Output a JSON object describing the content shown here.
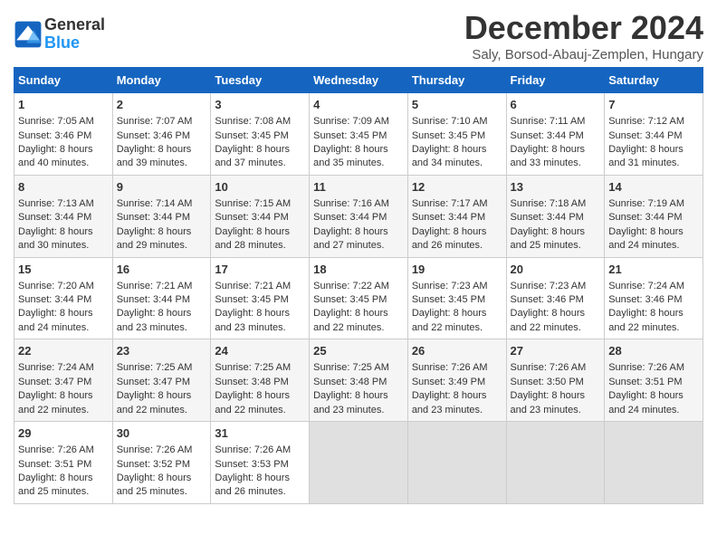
{
  "logo": {
    "text_general": "General",
    "text_blue": "Blue"
  },
  "title": "December 2024",
  "subtitle": "Saly, Borsod-Abauj-Zemplen, Hungary",
  "header": {
    "days": [
      "Sunday",
      "Monday",
      "Tuesday",
      "Wednesday",
      "Thursday",
      "Friday",
      "Saturday"
    ]
  },
  "weeks": [
    {
      "cells": [
        {
          "day": "1",
          "lines": [
            "Sunrise: 7:05 AM",
            "Sunset: 3:46 PM",
            "Daylight: 8 hours",
            "and 40 minutes."
          ]
        },
        {
          "day": "2",
          "lines": [
            "Sunrise: 7:07 AM",
            "Sunset: 3:46 PM",
            "Daylight: 8 hours",
            "and 39 minutes."
          ]
        },
        {
          "day": "3",
          "lines": [
            "Sunrise: 7:08 AM",
            "Sunset: 3:45 PM",
            "Daylight: 8 hours",
            "and 37 minutes."
          ]
        },
        {
          "day": "4",
          "lines": [
            "Sunrise: 7:09 AM",
            "Sunset: 3:45 PM",
            "Daylight: 8 hours",
            "and 35 minutes."
          ]
        },
        {
          "day": "5",
          "lines": [
            "Sunrise: 7:10 AM",
            "Sunset: 3:45 PM",
            "Daylight: 8 hours",
            "and 34 minutes."
          ]
        },
        {
          "day": "6",
          "lines": [
            "Sunrise: 7:11 AM",
            "Sunset: 3:44 PM",
            "Daylight: 8 hours",
            "and 33 minutes."
          ]
        },
        {
          "day": "7",
          "lines": [
            "Sunrise: 7:12 AM",
            "Sunset: 3:44 PM",
            "Daylight: 8 hours",
            "and 31 minutes."
          ]
        }
      ]
    },
    {
      "cells": [
        {
          "day": "8",
          "lines": [
            "Sunrise: 7:13 AM",
            "Sunset: 3:44 PM",
            "Daylight: 8 hours",
            "and 30 minutes."
          ]
        },
        {
          "day": "9",
          "lines": [
            "Sunrise: 7:14 AM",
            "Sunset: 3:44 PM",
            "Daylight: 8 hours",
            "and 29 minutes."
          ]
        },
        {
          "day": "10",
          "lines": [
            "Sunrise: 7:15 AM",
            "Sunset: 3:44 PM",
            "Daylight: 8 hours",
            "and 28 minutes."
          ]
        },
        {
          "day": "11",
          "lines": [
            "Sunrise: 7:16 AM",
            "Sunset: 3:44 PM",
            "Daylight: 8 hours",
            "and 27 minutes."
          ]
        },
        {
          "day": "12",
          "lines": [
            "Sunrise: 7:17 AM",
            "Sunset: 3:44 PM",
            "Daylight: 8 hours",
            "and 26 minutes."
          ]
        },
        {
          "day": "13",
          "lines": [
            "Sunrise: 7:18 AM",
            "Sunset: 3:44 PM",
            "Daylight: 8 hours",
            "and 25 minutes."
          ]
        },
        {
          "day": "14",
          "lines": [
            "Sunrise: 7:19 AM",
            "Sunset: 3:44 PM",
            "Daylight: 8 hours",
            "and 24 minutes."
          ]
        }
      ]
    },
    {
      "cells": [
        {
          "day": "15",
          "lines": [
            "Sunrise: 7:20 AM",
            "Sunset: 3:44 PM",
            "Daylight: 8 hours",
            "and 24 minutes."
          ]
        },
        {
          "day": "16",
          "lines": [
            "Sunrise: 7:21 AM",
            "Sunset: 3:44 PM",
            "Daylight: 8 hours",
            "and 23 minutes."
          ]
        },
        {
          "day": "17",
          "lines": [
            "Sunrise: 7:21 AM",
            "Sunset: 3:45 PM",
            "Daylight: 8 hours",
            "and 23 minutes."
          ]
        },
        {
          "day": "18",
          "lines": [
            "Sunrise: 7:22 AM",
            "Sunset: 3:45 PM",
            "Daylight: 8 hours",
            "and 22 minutes."
          ]
        },
        {
          "day": "19",
          "lines": [
            "Sunrise: 7:23 AM",
            "Sunset: 3:45 PM",
            "Daylight: 8 hours",
            "and 22 minutes."
          ]
        },
        {
          "day": "20",
          "lines": [
            "Sunrise: 7:23 AM",
            "Sunset: 3:46 PM",
            "Daylight: 8 hours",
            "and 22 minutes."
          ]
        },
        {
          "day": "21",
          "lines": [
            "Sunrise: 7:24 AM",
            "Sunset: 3:46 PM",
            "Daylight: 8 hours",
            "and 22 minutes."
          ]
        }
      ]
    },
    {
      "cells": [
        {
          "day": "22",
          "lines": [
            "Sunrise: 7:24 AM",
            "Sunset: 3:47 PM",
            "Daylight: 8 hours",
            "and 22 minutes."
          ]
        },
        {
          "day": "23",
          "lines": [
            "Sunrise: 7:25 AM",
            "Sunset: 3:47 PM",
            "Daylight: 8 hours",
            "and 22 minutes."
          ]
        },
        {
          "day": "24",
          "lines": [
            "Sunrise: 7:25 AM",
            "Sunset: 3:48 PM",
            "Daylight: 8 hours",
            "and 22 minutes."
          ]
        },
        {
          "day": "25",
          "lines": [
            "Sunrise: 7:25 AM",
            "Sunset: 3:48 PM",
            "Daylight: 8 hours",
            "and 23 minutes."
          ]
        },
        {
          "day": "26",
          "lines": [
            "Sunrise: 7:26 AM",
            "Sunset: 3:49 PM",
            "Daylight: 8 hours",
            "and 23 minutes."
          ]
        },
        {
          "day": "27",
          "lines": [
            "Sunrise: 7:26 AM",
            "Sunset: 3:50 PM",
            "Daylight: 8 hours",
            "and 23 minutes."
          ]
        },
        {
          "day": "28",
          "lines": [
            "Sunrise: 7:26 AM",
            "Sunset: 3:51 PM",
            "Daylight: 8 hours",
            "and 24 minutes."
          ]
        }
      ]
    },
    {
      "cells": [
        {
          "day": "29",
          "lines": [
            "Sunrise: 7:26 AM",
            "Sunset: 3:51 PM",
            "Daylight: 8 hours",
            "and 25 minutes."
          ]
        },
        {
          "day": "30",
          "lines": [
            "Sunrise: 7:26 AM",
            "Sunset: 3:52 PM",
            "Daylight: 8 hours",
            "and 25 minutes."
          ]
        },
        {
          "day": "31",
          "lines": [
            "Sunrise: 7:26 AM",
            "Sunset: 3:53 PM",
            "Daylight: 8 hours",
            "and 26 minutes."
          ]
        },
        {
          "day": "",
          "lines": []
        },
        {
          "day": "",
          "lines": []
        },
        {
          "day": "",
          "lines": []
        },
        {
          "day": "",
          "lines": []
        }
      ]
    }
  ]
}
